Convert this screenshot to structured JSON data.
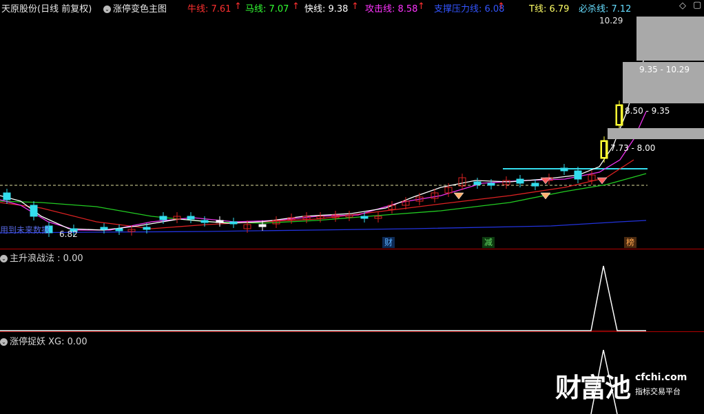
{
  "header": {
    "stock_title": "天原股份(日线 前复权)",
    "indicator_name": "涨停变色主图",
    "lines": [
      {
        "label": "牛线: 7.61",
        "arrow": "↑",
        "color": "#ff3030"
      },
      {
        "label": "马线: 7.07",
        "arrow": "↑",
        "color": "#33ff33"
      },
      {
        "label": "快线: 9.38",
        "arrow": "↑",
        "color": "#ffffff"
      },
      {
        "label": "攻击线: 8.58",
        "arrow": "↑",
        "color": "#ff33ff"
      },
      {
        "label": "支撑压力线: 6.08",
        "arrow": "↑",
        "color": "#3355ff"
      },
      {
        "label": "T线: 6.79",
        "arrow": "",
        "color": "#ffff66"
      },
      {
        "label": "必杀线: 7.12",
        "arrow": "",
        "color": "#66ddff"
      }
    ]
  },
  "main_chart": {
    "price_high_label": "10.29",
    "price_low_label": "6.82",
    "left_note": "用到未来数据",
    "markers": [
      {
        "text": "财",
        "color": "#4aa3ff"
      },
      {
        "text": "减",
        "color": "#33cc33"
      },
      {
        "text": "榜",
        "color": "#ff9933"
      }
    ],
    "ranges": [
      "9.35 - 10.29",
      "8.50 - 9.35",
      "7.73 - 8.00"
    ]
  },
  "panel2": {
    "title": "主升浪战法",
    "value": ": 0.00"
  },
  "panel3": {
    "title": "涨停捉妖",
    "value": "XG: 0.00"
  },
  "watermark": {
    "brand": "财富池",
    "site": "cfchi.com",
    "slogan": "指标交易平台"
  }
}
